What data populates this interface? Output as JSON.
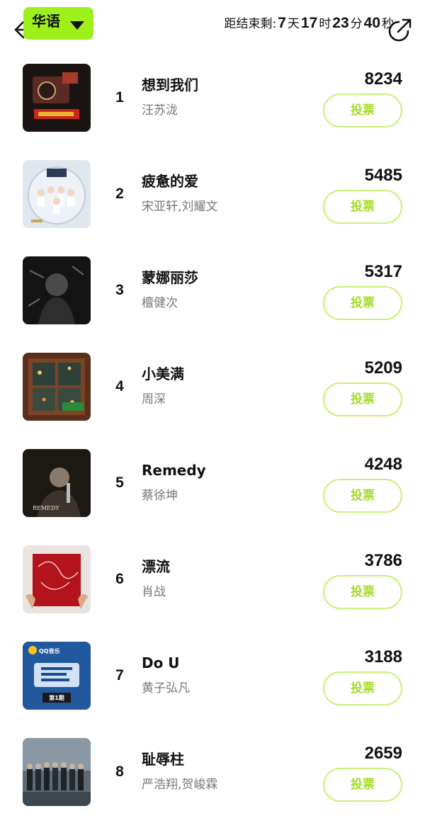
{
  "header": {
    "language": "华语",
    "countdown": {
      "prefix": "距结束剩:",
      "days": "7",
      "days_unit": "天",
      "hours": "17",
      "hours_unit": "时",
      "minutes": "23",
      "minutes_unit": "分",
      "seconds": "40",
      "seconds_unit": "秒"
    }
  },
  "songs": [
    {
      "rank": "1",
      "title": "想到我们",
      "artist": "汪苏泷",
      "votes": "8234",
      "vote_label": "投票"
    },
    {
      "rank": "2",
      "title": "疲惫的爱",
      "artist": "宋亚轩,刘耀文",
      "votes": "5485",
      "vote_label": "投票"
    },
    {
      "rank": "3",
      "title": "蒙娜丽莎",
      "artist": "檀健次",
      "votes": "5317",
      "vote_label": "投票"
    },
    {
      "rank": "4",
      "title": "小美满",
      "artist": "周深",
      "votes": "5209",
      "vote_label": "投票"
    },
    {
      "rank": "5",
      "title": "Remedy",
      "artist": "蔡徐坤",
      "votes": "4248",
      "vote_label": "投票"
    },
    {
      "rank": "6",
      "title": "漂流",
      "artist": "肖战",
      "votes": "3786",
      "vote_label": "投票"
    },
    {
      "rank": "7",
      "title": "Do U",
      "artist": "黄子弘凡",
      "votes": "3188",
      "vote_label": "投票"
    },
    {
      "rank": "8",
      "title": "耻辱柱",
      "artist": "严浩翔,贺峻霖",
      "votes": "2659",
      "vote_label": "投票"
    }
  ],
  "cover_logos": {
    "cover_7": "QQ音乐",
    "cover_7_episode": "第1期",
    "cover_5": "REMEDY"
  },
  "colors": {
    "accent": "#9ef01a",
    "vote_border": "#c9f07a",
    "vote_text": "#a6dc2a"
  }
}
